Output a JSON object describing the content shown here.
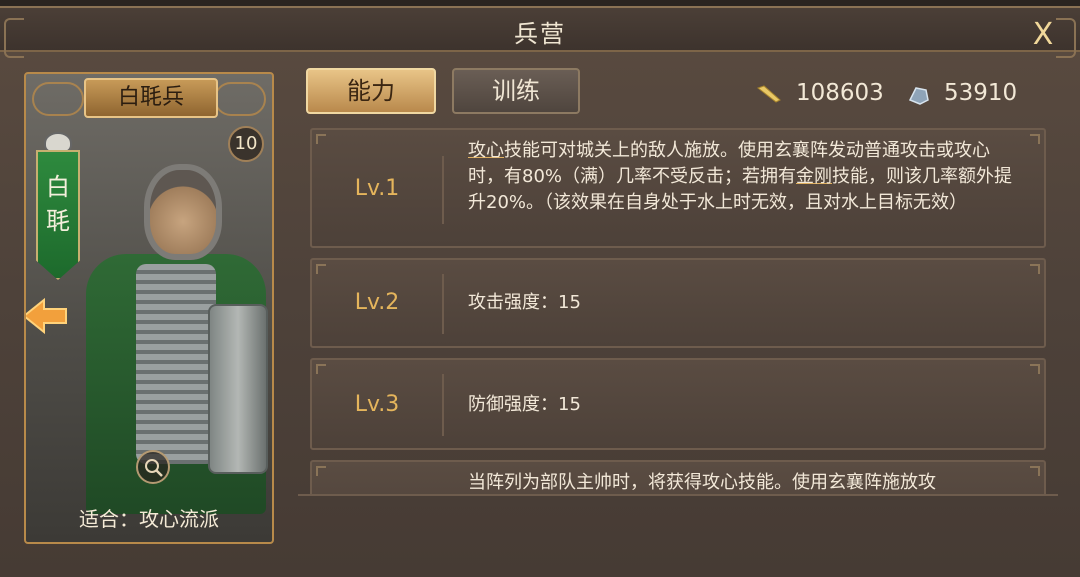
{
  "window": {
    "title": "兵营",
    "close_label": "X"
  },
  "card": {
    "unit_name": "白毦兵",
    "level": "10",
    "banner_text": "白\n毦",
    "suit_label": "适合：攻心流派"
  },
  "tabs": [
    {
      "label": "能力",
      "active": true
    },
    {
      "label": "训练",
      "active": false
    }
  ],
  "resources": [
    {
      "icon": "grain-icon",
      "value": "108603"
    },
    {
      "icon": "iron-icon",
      "value": "53910"
    }
  ],
  "abilities": [
    {
      "level": "Lv.1",
      "desc_part1": "攻心",
      "desc_part2": "技能可对城关上的敌人施放。使用玄襄阵发动普通攻击或攻心时，有80%（满）几率不受反击；若拥有",
      "desc_part3": "金刚",
      "desc_part4": "技能，则该几率额外提升20%。（该效果在自身处于水上时无效，且对水上目标无效）"
    },
    {
      "level": "Lv.2",
      "desc": "攻击强度：15"
    },
    {
      "level": "Lv.3",
      "desc": "防御强度：15"
    },
    {
      "level": "",
      "desc": "当阵列为部队主帅时，将获得攻心技能。使用玄襄阵施放攻"
    }
  ],
  "colors": {
    "accent_gold": "#e5b55c",
    "panel_brown": "#4e423a",
    "banner_green": "#2e8a3e"
  }
}
